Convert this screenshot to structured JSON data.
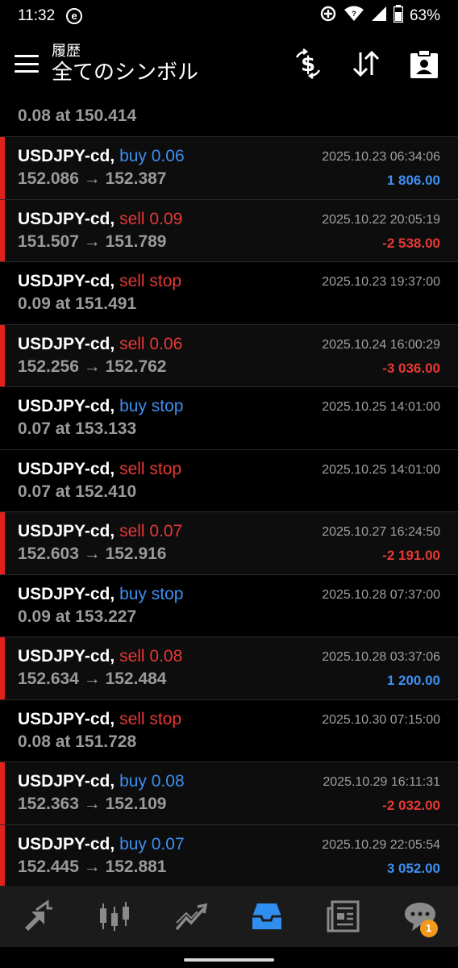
{
  "status_bar": {
    "time": "11:32",
    "app_badge": "e",
    "battery": "63%"
  },
  "header": {
    "subtitle": "履歴",
    "title": "全てのシンボル"
  },
  "partial_row": {
    "line2": "0.08 at 150.414"
  },
  "trades": [
    {
      "symbol": "USDJPY-cd,",
      "type": "buy 0.06",
      "side": "buy",
      "prices": "152.086 → 152.387",
      "time": "2025.10.23 06:34:06",
      "profit": "1 806.00",
      "sign": "pos",
      "filled": true
    },
    {
      "symbol": "USDJPY-cd,",
      "type": "sell 0.09",
      "side": "sell",
      "prices": "151.507 → 151.789",
      "time": "2025.10.22 20:05:19",
      "profit": "-2 538.00",
      "sign": "neg",
      "filled": true
    },
    {
      "symbol": "USDJPY-cd,",
      "type": "sell stop",
      "side": "sell",
      "prices": "0.09 at 151.491",
      "time": "2025.10.23 19:37:00",
      "profit": "",
      "sign": "",
      "filled": false
    },
    {
      "symbol": "USDJPY-cd,",
      "type": "sell 0.06",
      "side": "sell",
      "prices": "152.256 → 152.762",
      "time": "2025.10.24 16:00:29",
      "profit": "-3 036.00",
      "sign": "neg",
      "filled": true
    },
    {
      "symbol": "USDJPY-cd,",
      "type": "buy stop",
      "side": "buy",
      "prices": "0.07 at 153.133",
      "time": "2025.10.25 14:01:00",
      "profit": "",
      "sign": "",
      "filled": false
    },
    {
      "symbol": "USDJPY-cd,",
      "type": "sell stop",
      "side": "sell",
      "prices": "0.07 at 152.410",
      "time": "2025.10.25 14:01:00",
      "profit": "",
      "sign": "",
      "filled": false
    },
    {
      "symbol": "USDJPY-cd,",
      "type": "sell 0.07",
      "side": "sell",
      "prices": "152.603 → 152.916",
      "time": "2025.10.27 16:24:50",
      "profit": "-2 191.00",
      "sign": "neg",
      "filled": true
    },
    {
      "symbol": "USDJPY-cd,",
      "type": "buy stop",
      "side": "buy",
      "prices": "0.09 at 153.227",
      "time": "2025.10.28 07:37:00",
      "profit": "",
      "sign": "",
      "filled": false
    },
    {
      "symbol": "USDJPY-cd,",
      "type": "sell 0.08",
      "side": "sell",
      "prices": "152.634 → 152.484",
      "time": "2025.10.28 03:37:06",
      "profit": "1 200.00",
      "sign": "pos",
      "filled": true
    },
    {
      "symbol": "USDJPY-cd,",
      "type": "sell stop",
      "side": "sell",
      "prices": "0.08 at 151.728",
      "time": "2025.10.30 07:15:00",
      "profit": "",
      "sign": "",
      "filled": false
    },
    {
      "symbol": "USDJPY-cd,",
      "type": "buy 0.08",
      "side": "buy",
      "prices": "152.363 → 152.109",
      "time": "2025.10.29 16:11:31",
      "profit": "-2 032.00",
      "sign": "neg",
      "filled": true
    },
    {
      "symbol": "USDJPY-cd,",
      "type": "buy 0.07",
      "side": "buy",
      "prices": "152.445 → 152.881",
      "time": "2025.10.29 22:05:54",
      "profit": "3 052.00",
      "sign": "pos",
      "filled": true
    }
  ],
  "bottom_nav": {
    "items": [
      "quotes-icon",
      "chart-icon",
      "trade-icon",
      "history-icon",
      "news-icon",
      "chat-icon"
    ],
    "active": "history-icon",
    "chat_badge": "1"
  },
  "colors": {
    "buy": "#3d8ff0",
    "sell": "#e53935",
    "accent": "#2f8ef0",
    "badge": "#f39a1e"
  }
}
